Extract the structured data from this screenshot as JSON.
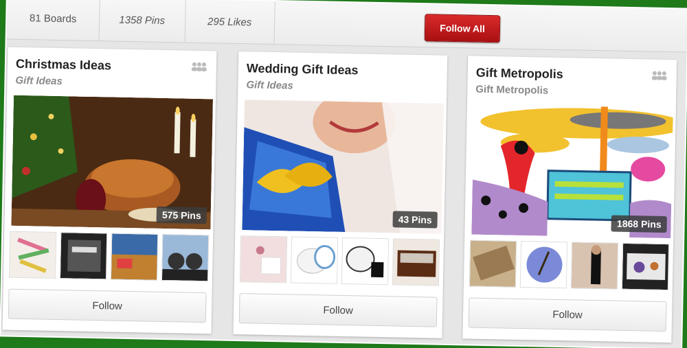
{
  "stats": {
    "boards": "81 Boards",
    "pins": "1358 Pins",
    "likes": "295 Likes"
  },
  "follow_all_label": "Follow All",
  "boards": [
    {
      "title": "Christmas Ideas",
      "subtitle": "Gift Ideas",
      "pins": "575 Pins",
      "follow": "Follow"
    },
    {
      "title": "Wedding Gift Ideas",
      "subtitle": "Gift Ideas",
      "pins": "43 Pins",
      "follow": "Follow"
    },
    {
      "title": "Gift Metropolis",
      "subtitle": "Gift Metropolis",
      "pins": "1868 Pins",
      "follow": "Follow"
    }
  ],
  "icons": {
    "group": "group-icon"
  },
  "colors": {
    "follow_all_red": "#c81d20",
    "background_green": "#1f7a1a"
  }
}
